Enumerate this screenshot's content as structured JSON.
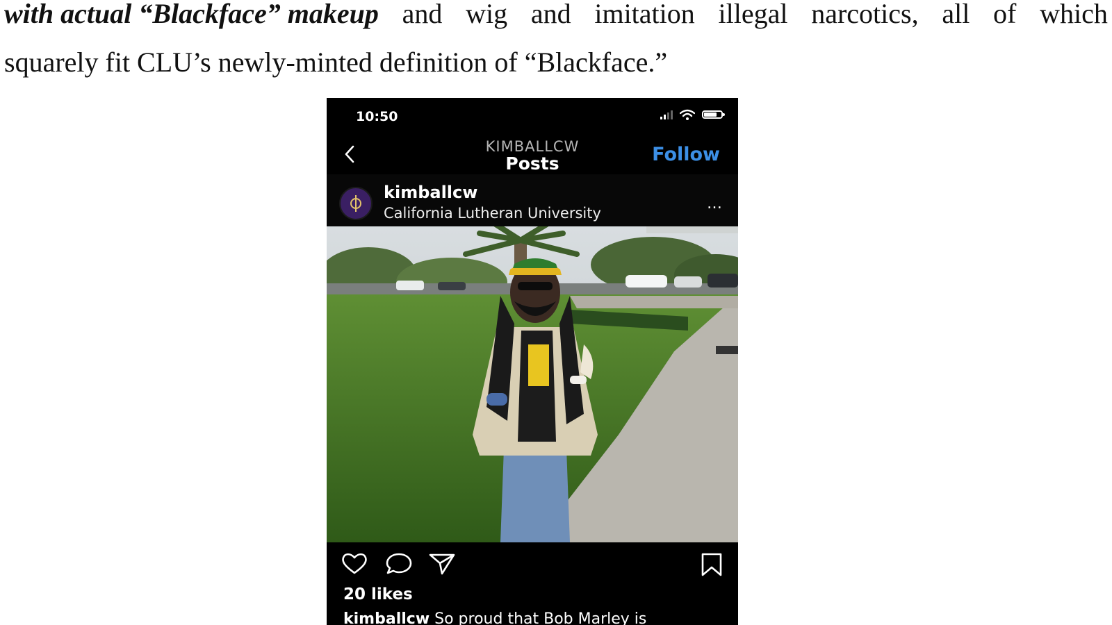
{
  "document": {
    "line1_emphasis": "with actual “Blackface” makeup",
    "line1_words": [
      "and",
      "wig",
      "and",
      "imitation",
      "illegal",
      "narcotics,",
      "all",
      "of",
      "which"
    ],
    "line2": "squarely fit CLU’s newly-minted definition of “Blackface.”"
  },
  "phone": {
    "status_time": "10:50",
    "nav_subtitle": "KIMBALLCW",
    "nav_title": "Posts",
    "follow_label": "Follow",
    "post": {
      "username": "kimballcw",
      "location": "California Lutheran University",
      "more_label": "…",
      "likes": "20 likes",
      "caption_user": "kimballcw",
      "caption_text": "So proud that Bob Marley is"
    },
    "icons": [
      "chevron-left-icon",
      "cellular-signal-icon",
      "wifi-icon",
      "battery-icon",
      "heart-icon",
      "comment-icon",
      "share-icon",
      "bookmark-icon"
    ],
    "colors": {
      "follow": "#3c8fe6",
      "background": "#000000",
      "avatar": "#3a1f63"
    }
  }
}
